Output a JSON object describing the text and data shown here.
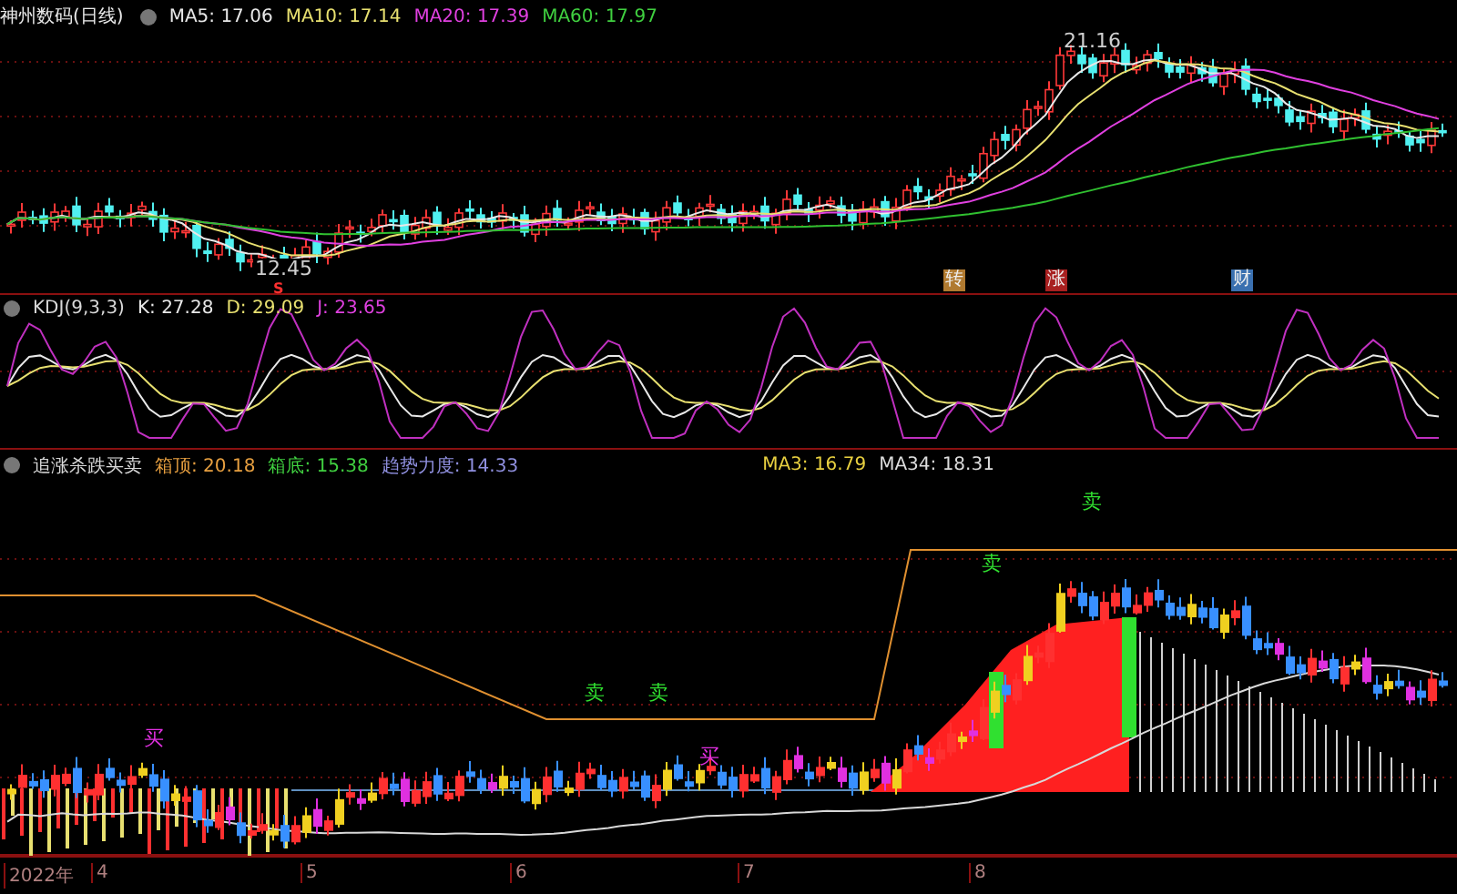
{
  "chart_title": "神州数码(日线)",
  "main_indicators": [
    {
      "label": "MA5: 17.06",
      "color": "#e8e8e8"
    },
    {
      "label": "MA10: 17.14",
      "color": "#e8e070"
    },
    {
      "label": "MA20: 17.39",
      "color": "#e040e0"
    },
    {
      "label": "MA60: 17.97",
      "color": "#40d040"
    }
  ],
  "price_labels": [
    "21.16",
    "12.45"
  ],
  "event_tags": [
    {
      "text": "转",
      "color": "#b07a30"
    },
    {
      "text": "涨",
      "color": "#a82020"
    },
    {
      "text": "财",
      "color": "#3a70b0"
    }
  ],
  "signal": "S",
  "kdj_title": "KDJ(9,3,3)",
  "kdj_values": [
    {
      "label": "K: 27.28",
      "color": "#e8e8e8"
    },
    {
      "label": "D: 29.09",
      "color": "#e8e070"
    },
    {
      "label": "J: 23.65",
      "color": "#e040e0"
    }
  ],
  "lower_title": "追涨杀跌买卖",
  "lower_values": [
    {
      "label": "箱顶: 20.18",
      "color": "#e8a040"
    },
    {
      "label": "箱底: 15.38",
      "color": "#40d040"
    },
    {
      "label": "趋势力度: 14.33",
      "color": "#9090e0"
    }
  ],
  "lower_ma": [
    {
      "label": "MA3: 16.79",
      "color": "#e8d040"
    },
    {
      "label": "MA34: 18.31",
      "color": "#dddddd"
    }
  ],
  "sell_marks": [
    "卖",
    "卖",
    "卖",
    "卖"
  ],
  "buy_marks": [
    "买",
    "买"
  ],
  "time_axis": [
    "2022年",
    "4",
    "5",
    "6",
    "7",
    "8"
  ]
}
